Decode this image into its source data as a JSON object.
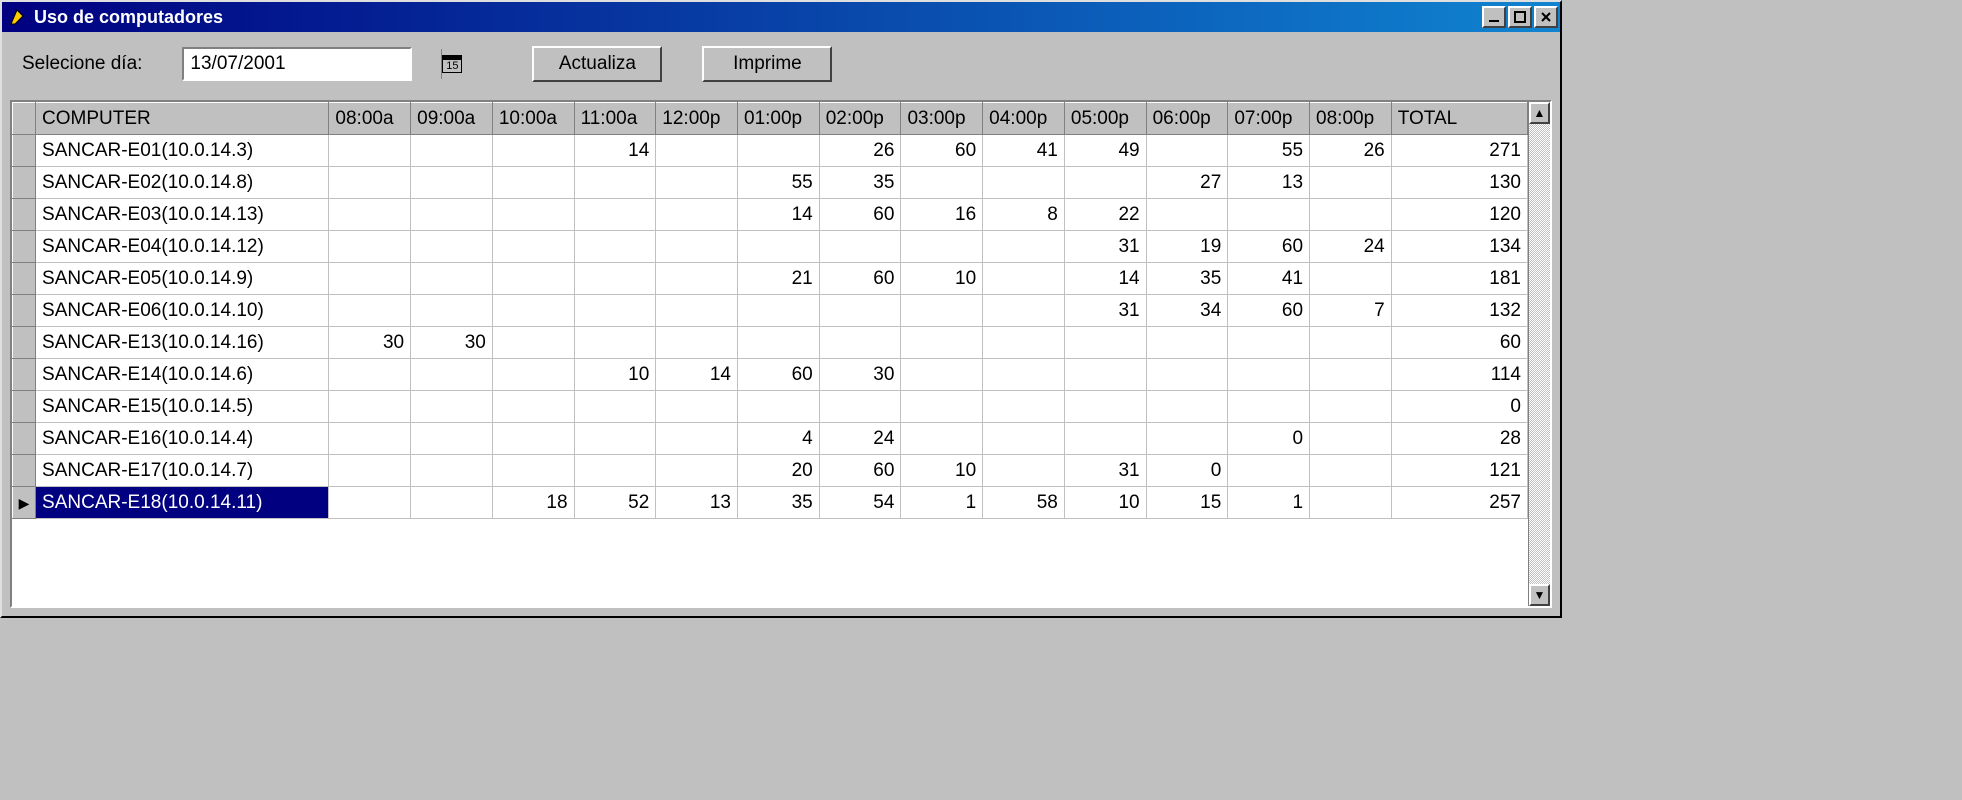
{
  "window": {
    "title": "Uso de computadores"
  },
  "toolbar": {
    "select_day_label": "Selecione día:",
    "date_value": "13/07/2001",
    "calendar_day_glyph": "15",
    "actualiza_label": "Actualiza",
    "imprime_label": "Imprime"
  },
  "grid": {
    "headers": {
      "computer": "COMPUTER",
      "h08": "08:00a",
      "h09": "09:00a",
      "h10": "10:00a",
      "h11": "11:00a",
      "h12": "12:00p",
      "h13": "01:00p",
      "h14": "02:00p",
      "h15": "03:00p",
      "h16": "04:00p",
      "h17": "05:00p",
      "h18": "06:00p",
      "h19": "07:00p",
      "h20": "08:00p",
      "total": "TOTAL"
    },
    "rows": [
      {
        "name": "SANCAR-E01(10.0.14.3)",
        "h08": "",
        "h09": "",
        "h10": "",
        "h11": "14",
        "h12": "",
        "h13": "",
        "h14": "26",
        "h15": "60",
        "h16": "41",
        "h17": "49",
        "h18": "",
        "h19": "55",
        "h20": "26",
        "total": "271"
      },
      {
        "name": "SANCAR-E02(10.0.14.8)",
        "h08": "",
        "h09": "",
        "h10": "",
        "h11": "",
        "h12": "",
        "h13": "55",
        "h14": "35",
        "h15": "",
        "h16": "",
        "h17": "",
        "h18": "27",
        "h19": "13",
        "h20": "",
        "total": "130"
      },
      {
        "name": "SANCAR-E03(10.0.14.13)",
        "h08": "",
        "h09": "",
        "h10": "",
        "h11": "",
        "h12": "",
        "h13": "14",
        "h14": "60",
        "h15": "16",
        "h16": "8",
        "h17": "22",
        "h18": "",
        "h19": "",
        "h20": "",
        "total": "120"
      },
      {
        "name": "SANCAR-E04(10.0.14.12)",
        "h08": "",
        "h09": "",
        "h10": "",
        "h11": "",
        "h12": "",
        "h13": "",
        "h14": "",
        "h15": "",
        "h16": "",
        "h17": "31",
        "h18": "19",
        "h19": "60",
        "h20": "24",
        "total": "134"
      },
      {
        "name": "SANCAR-E05(10.0.14.9)",
        "h08": "",
        "h09": "",
        "h10": "",
        "h11": "",
        "h12": "",
        "h13": "21",
        "h14": "60",
        "h15": "10",
        "h16": "",
        "h17": "14",
        "h18": "35",
        "h19": "41",
        "h20": "",
        "total": "181"
      },
      {
        "name": "SANCAR-E06(10.0.14.10)",
        "h08": "",
        "h09": "",
        "h10": "",
        "h11": "",
        "h12": "",
        "h13": "",
        "h14": "",
        "h15": "",
        "h16": "",
        "h17": "31",
        "h18": "34",
        "h19": "60",
        "h20": "7",
        "total": "132"
      },
      {
        "name": "SANCAR-E13(10.0.14.16)",
        "h08": "30",
        "h09": "30",
        "h10": "",
        "h11": "",
        "h12": "",
        "h13": "",
        "h14": "",
        "h15": "",
        "h16": "",
        "h17": "",
        "h18": "",
        "h19": "",
        "h20": "",
        "total": "60"
      },
      {
        "name": "SANCAR-E14(10.0.14.6)",
        "h08": "",
        "h09": "",
        "h10": "",
        "h11": "10",
        "h12": "14",
        "h13": "60",
        "h14": "30",
        "h15": "",
        "h16": "",
        "h17": "",
        "h18": "",
        "h19": "",
        "h20": "",
        "total": "114"
      },
      {
        "name": "SANCAR-E15(10.0.14.5)",
        "h08": "",
        "h09": "",
        "h10": "",
        "h11": "",
        "h12": "",
        "h13": "",
        "h14": "",
        "h15": "",
        "h16": "",
        "h17": "",
        "h18": "",
        "h19": "",
        "h20": "",
        "total": "0"
      },
      {
        "name": "SANCAR-E16(10.0.14.4)",
        "h08": "",
        "h09": "",
        "h10": "",
        "h11": "",
        "h12": "",
        "h13": "4",
        "h14": "24",
        "h15": "",
        "h16": "",
        "h17": "",
        "h18": "",
        "h19": "0",
        "h20": "",
        "total": "28"
      },
      {
        "name": "SANCAR-E17(10.0.14.7)",
        "h08": "",
        "h09": "",
        "h10": "",
        "h11": "",
        "h12": "",
        "h13": "20",
        "h14": "60",
        "h15": "10",
        "h16": "",
        "h17": "31",
        "h18": "0",
        "h19": "",
        "h20": "",
        "total": "121"
      },
      {
        "name": "SANCAR-E18(10.0.14.11)",
        "h08": "",
        "h09": "",
        "h10": "18",
        "h11": "52",
        "h12": "13",
        "h13": "35",
        "h14": "54",
        "h15": "1",
        "h16": "58",
        "h17": "10",
        "h18": "15",
        "h19": "1",
        "h20": "",
        "total": "257",
        "selected": true
      }
    ]
  }
}
